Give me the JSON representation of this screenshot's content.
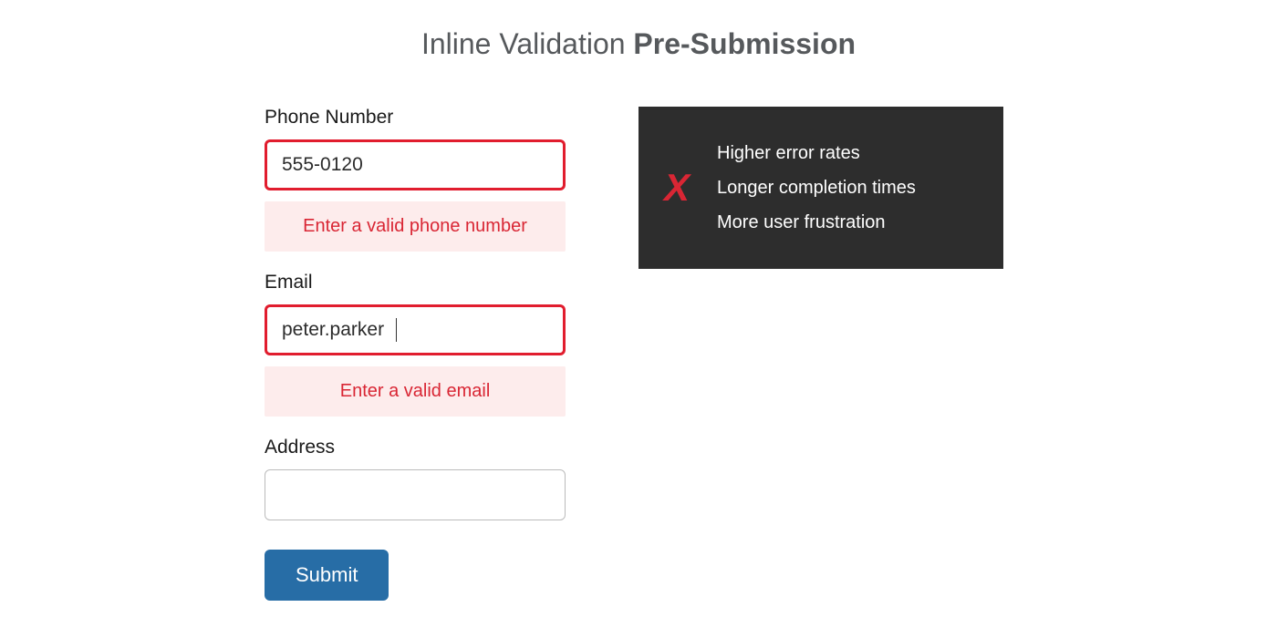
{
  "heading": {
    "light": "Inline Validation ",
    "bold": "Pre-Submission"
  },
  "form": {
    "phone": {
      "label": "Phone Number",
      "value": "555-0120",
      "error": "Enter a valid phone number"
    },
    "email": {
      "label": "Email",
      "value": "peter.parker",
      "error": "Enter a valid email"
    },
    "address": {
      "label": "Address",
      "value": ""
    },
    "submit_label": "Submit"
  },
  "info": {
    "icon": "X",
    "items": [
      "Higher error rates",
      "Longer completion times",
      "More user frustration"
    ]
  }
}
